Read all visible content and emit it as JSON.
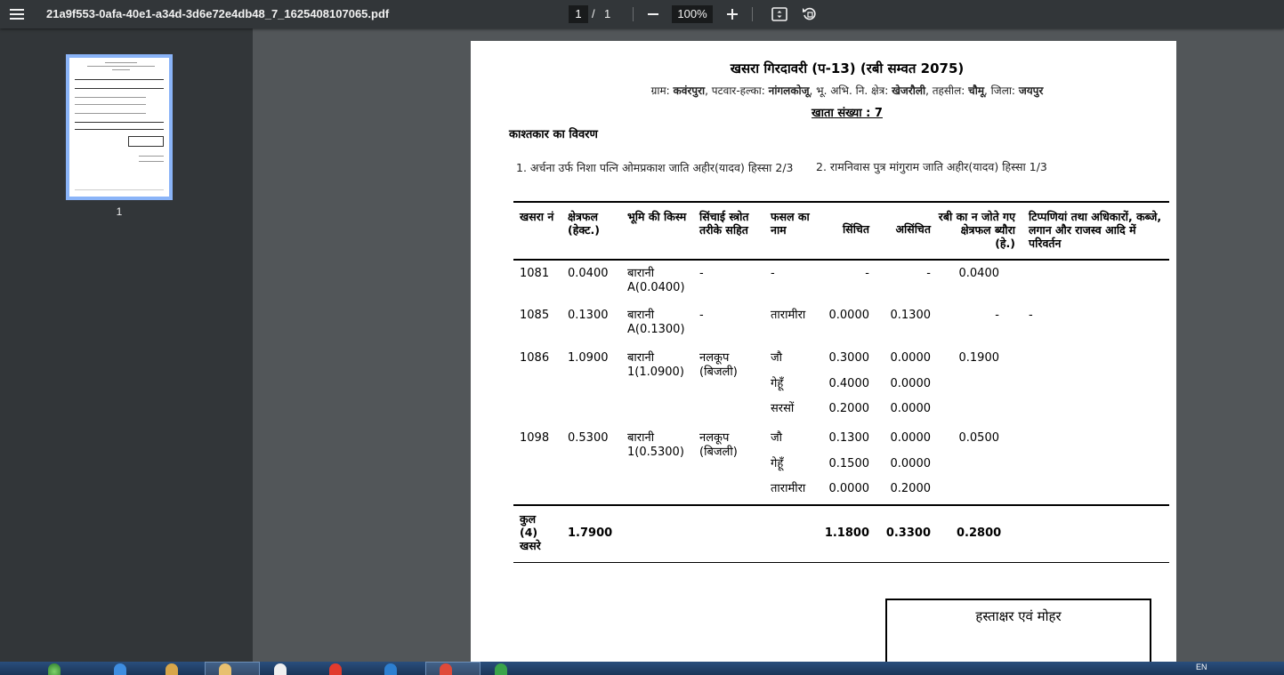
{
  "toolbar": {
    "title": "21a9f553-0afa-40e1-a34d-3d6e72e4db48_7_1625408107065.pdf",
    "page_current": "1",
    "page_sep": "/",
    "page_total": "1",
    "zoom": "100%"
  },
  "sidebar": {
    "thumb_label": "1"
  },
  "doc": {
    "title": "खसरा गिरदावरी (प-13) (रबी सम्वत 2075)",
    "sub": {
      "gram_label": "ग्राम:",
      "gram": "कवंरपुरा",
      "halka_label": ", पटवार-हल्का:",
      "halka": "नांगलकोजू",
      "kshetra_label": ", भू. अभि. नि. क्षेत्र:",
      "kshetra": "खेजरौली",
      "tehsil_label": ", तहसील:",
      "tehsil": "चौमू",
      "zila_label": ", जिला:",
      "zila": "जयपुर"
    },
    "khata": "खाता संख्या : 7",
    "section": "काश्तकार का विवरण",
    "owner1": "1. अर्चना उर्फ निशा पत्नि ओमप्रकाश जाति अहीर(यादव) हिस्सा 2/3",
    "owner2": "2. रामनिवास पुत्र मांगुराम जाति अहीर(यादव) हिस्सा 1/3",
    "headers": {
      "khasra": "खसरा नं",
      "area": "क्षेत्रफल (हेक्ट.)",
      "land": "भूमि की किस्म",
      "irrig": "सिंचाई स्त्रोत तरीके सहित",
      "crop": "फसल का नाम",
      "sinchit": "सिंचित",
      "asinchit": "असिंचित",
      "rabi": "रबी का न जोते गए क्षेत्रफल ब्यौरा (हे.)",
      "remarks": "टिप्पणियां तथा अधिकारों, कब्जे, लगान और राजस्व आदि में परिवर्तन"
    },
    "rows": [
      {
        "khasra": "1081",
        "area": "0.0400",
        "land": "बारानी A(0.0400)",
        "irrig": "-",
        "rabi": "0.0400",
        "remarks": "",
        "crops": [
          {
            "name": "-",
            "sinchit": "-",
            "asinchit": "-"
          }
        ]
      },
      {
        "khasra": "1085",
        "area": "0.1300",
        "land": "बारानी A(0.1300)",
        "irrig": "-",
        "rabi": "-",
        "remarks": "-",
        "crops": [
          {
            "name": "तारामीरा",
            "sinchit": "0.0000",
            "asinchit": "0.1300"
          }
        ]
      },
      {
        "khasra": "1086",
        "area": "1.0900",
        "land": "बारानी 1(1.0900)",
        "irrig": "नलकूप (बिजली)",
        "rabi": "0.1900",
        "remarks": "",
        "crops": [
          {
            "name": "जौ",
            "sinchit": "0.3000",
            "asinchit": "0.0000"
          },
          {
            "name": "गेहूँ",
            "sinchit": "0.4000",
            "asinchit": "0.0000"
          },
          {
            "name": "सरसों",
            "sinchit": "0.2000",
            "asinchit": "0.0000"
          }
        ]
      },
      {
        "khasra": "1098",
        "area": "0.5300",
        "land": "बारानी 1(0.5300)",
        "irrig": "नलकूप (बिजली)",
        "rabi": "0.0500",
        "remarks": "",
        "crops": [
          {
            "name": "जौ",
            "sinchit": "0.1300",
            "asinchit": "0.0000"
          },
          {
            "name": "गेहूँ",
            "sinchit": "0.1500",
            "asinchit": "0.0000"
          },
          {
            "name": "तारामीरा",
            "sinchit": "0.0000",
            "asinchit": "0.2000"
          }
        ]
      }
    ],
    "total": {
      "label": "कुल (4) खसरे",
      "area": "1.7900",
      "sinchit": "1.1800",
      "asinchit": "0.3300",
      "rabi": "0.2800"
    },
    "signature": "हस्ताक्षर एवं मोहर"
  },
  "taskbar": {
    "lang": "EN"
  }
}
